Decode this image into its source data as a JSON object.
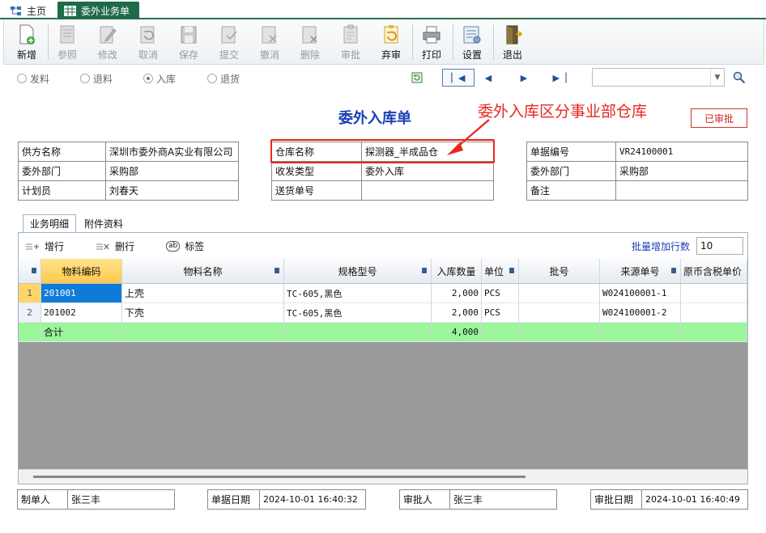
{
  "tabs": {
    "home": "主页",
    "active": "委外业务单"
  },
  "toolbar": [
    {
      "label": "新增",
      "enabled": true
    },
    {
      "label": "参照",
      "enabled": false
    },
    {
      "label": "修改",
      "enabled": false
    },
    {
      "label": "取消",
      "enabled": false
    },
    {
      "label": "保存",
      "enabled": false
    },
    {
      "label": "提交",
      "enabled": false
    },
    {
      "label": "撤消",
      "enabled": false
    },
    {
      "label": "删除",
      "enabled": false
    },
    {
      "label": "审批",
      "enabled": false
    },
    {
      "label": "弃审",
      "enabled": true
    },
    {
      "label": "打印",
      "enabled": true
    },
    {
      "label": "设置",
      "enabled": true
    },
    {
      "label": "退出",
      "enabled": true
    }
  ],
  "radios": {
    "r1": "发料",
    "r2": "退料",
    "r3": "入库",
    "r4": "退货",
    "selected": "入库"
  },
  "doc_title": "委外入库单",
  "annotation": "委外入库区分事业部仓库",
  "status": "已审批",
  "left_form": {
    "supplier_k": "供方名称",
    "supplier_v": "深圳市委外商A实业有限公司",
    "dept_k": "委外部门",
    "dept_v": "采购部",
    "planner_k": "计划员",
    "planner_v": "刘春天"
  },
  "mid_form": {
    "wh_k": "仓库名称",
    "wh_v": "探测器_半成品仓",
    "type_k": "收发类型",
    "type_v": "委外入库",
    "delivery_k": "送货单号",
    "delivery_v": ""
  },
  "right_form": {
    "no_k": "单据编号",
    "no_v": "VR24100001",
    "dept_k": "委外部门",
    "dept_v": "采购部",
    "note_k": "备注",
    "note_v": ""
  },
  "subtabs": {
    "detail": "业务明细",
    "attach": "附件资料"
  },
  "grid_bar": {
    "add": "增行",
    "del": "删行",
    "tag": "标签",
    "batch_label": "批量增加行数",
    "batch_value": "10"
  },
  "grid": {
    "headers": [
      "物料编码",
      "物料名称",
      "规格型号",
      "入库数量",
      "单位",
      "批号",
      "来源单号",
      "原币含税单价"
    ],
    "rows": [
      {
        "n": "1",
        "code": "201001",
        "name": "上壳",
        "spec": "TC-605,黑色",
        "qty": "2,000",
        "unit": "PCS",
        "batch": "",
        "src": "W024100001-1",
        "price": ""
      },
      {
        "n": "2",
        "code": "201002",
        "name": "下壳",
        "spec": "TC-605,黑色",
        "qty": "2,000",
        "unit": "PCS",
        "batch": "",
        "src": "W024100001-2",
        "price": ""
      }
    ],
    "total": {
      "label": "合计",
      "qty": "4,000"
    }
  },
  "footer": {
    "maker_k": "制单人",
    "maker_v": "张三丰",
    "date_k": "单据日期",
    "date_v": "2024-10-01 16:40:32",
    "approver_k": "审批人",
    "approver_v": "张三丰",
    "adate_k": "审批日期",
    "adate_v": "2024-10-01 16:40:49"
  },
  "colors": {
    "accent": "#1f6b49",
    "title": "#1b3fb5",
    "annotation": "#e8261e",
    "total_row": "#9bf59b",
    "selected_cell": "#0f7bd8",
    "header_sel": "#ffd566"
  }
}
